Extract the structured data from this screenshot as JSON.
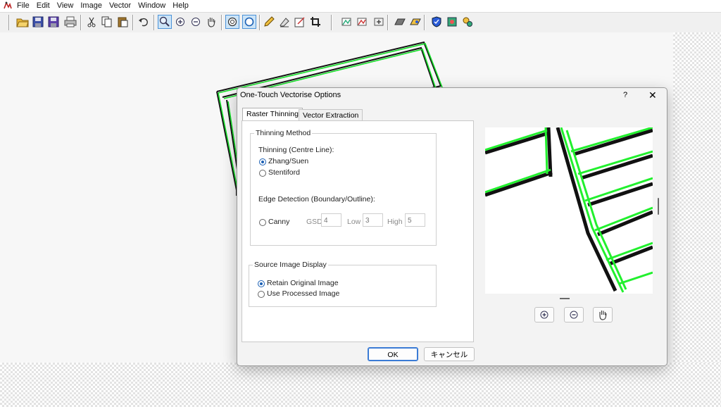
{
  "menubar": {
    "app_icon": "app-icon",
    "items": [
      "File",
      "Edit",
      "View",
      "Image",
      "Vector",
      "Window",
      "Help"
    ]
  },
  "toolbar": {
    "buttons": [
      "open-icon",
      "save-icon",
      "save-all-icon",
      "print-icon",
      "cut-icon",
      "copy-icon",
      "paste-icon",
      "undo-icon",
      "zoom-icon",
      "zoom-in-icon",
      "zoom-out-icon",
      "pan-icon",
      "select-1-icon",
      "select-2-icon",
      "pencil-icon",
      "eraser-icon",
      "edit-icon",
      "crop-icon",
      "tool-1-icon",
      "tool-2-icon",
      "tool-3-icon",
      "layers-icon",
      "fill-icon",
      "shield-icon",
      "settings-icon",
      "magic-icon"
    ]
  },
  "dialog": {
    "title": "One-Touch Vectorise Options",
    "help": "?",
    "close": "✕",
    "tabs": [
      "Raster Thinning",
      "Vector Extraction"
    ],
    "thinning_group": {
      "legend": "Thinning Method",
      "centre_line_label": "Thinning (Centre Line):",
      "options": [
        "Zhang/Suen",
        "Stentiford"
      ],
      "selected": "Zhang/Suen",
      "edge_label": "Edge Detection (Boundary/Outline):",
      "canny_label": "Canny",
      "gsd_label": "GSD",
      "gsd_value": "4",
      "low_label": "Low",
      "low_value": "3",
      "high_label": "High",
      "high_value": "5"
    },
    "source_group": {
      "legend": "Source Image Display",
      "options": [
        "Retain Original Image",
        "Use Processed Image"
      ],
      "selected": "Retain Original Image"
    },
    "preview_buttons": [
      "zoom-in-icon",
      "zoom-out-icon",
      "hand-pan-icon"
    ],
    "ok_label": "OK",
    "cancel_label": "キャンセル"
  }
}
